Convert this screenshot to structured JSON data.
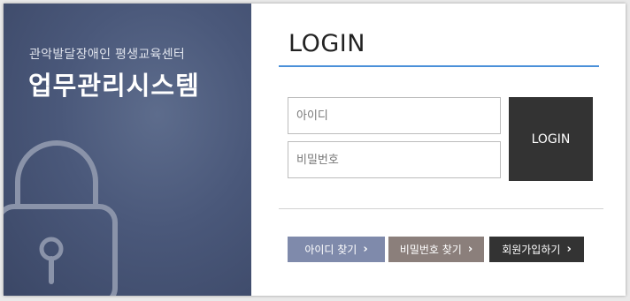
{
  "brand": {
    "org_name": "관악발달장애인 평생교육센터",
    "system_name": "업무관리시스템"
  },
  "login": {
    "title": "LOGIN",
    "id_placeholder": "아이디",
    "password_placeholder": "비밀번호",
    "submit_label": "LOGIN"
  },
  "links": [
    {
      "label": "아이디 찾기",
      "color": "#7f8aab",
      "icon": "chevron-right-icon"
    },
    {
      "label": "비밀번호 찾기",
      "color": "#8b7f7b",
      "icon": "chevron-right-icon"
    },
    {
      "label": "회원가입하기",
      "color": "#333333",
      "icon": "chevron-right-icon"
    }
  ],
  "colors": {
    "accent_rule": "#4a90d9",
    "panel": "#4a587a"
  },
  "decor": {
    "lock_icon": "padlock-icon"
  }
}
